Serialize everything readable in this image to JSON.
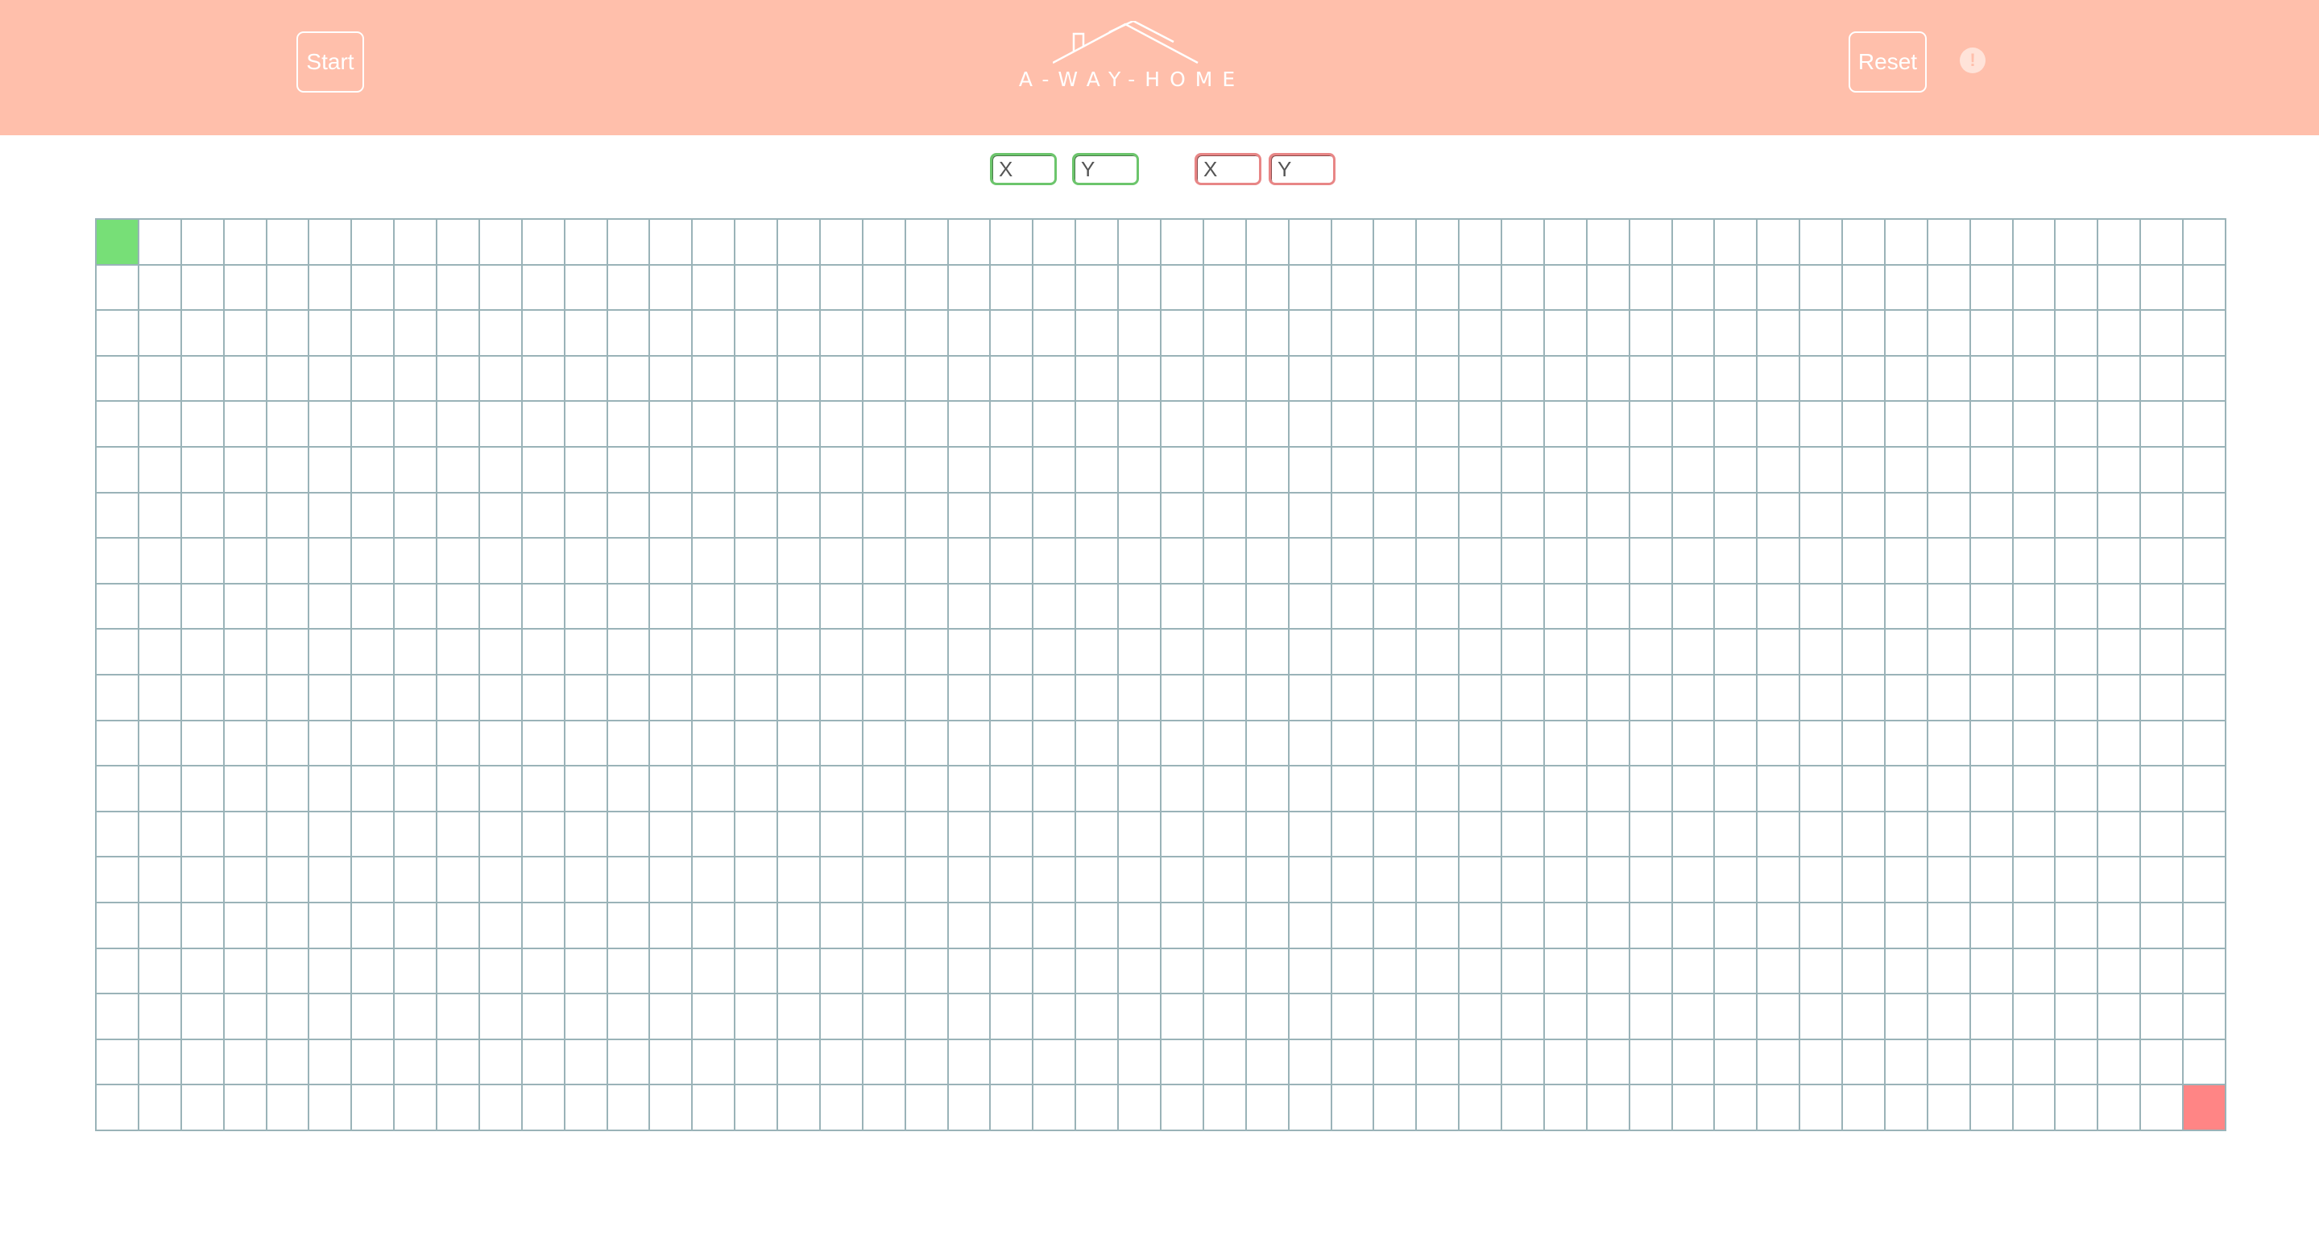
{
  "header": {
    "start_label": "Start",
    "reset_label": "Reset",
    "info_icon": "!",
    "logo_text": "A-WAY-HOME",
    "logo_icon": "house-roof-icon",
    "background_color": "#ffbfab"
  },
  "inputs": {
    "start_x_placeholder": "X",
    "start_y_placeholder": "Y",
    "end_x_placeholder": "X",
    "end_y_placeholder": "Y",
    "start_color": "#6cc56c",
    "end_color": "#e88686"
  },
  "grid": {
    "columns": 50,
    "rows": 20,
    "start_cell": {
      "row": 0,
      "col": 0,
      "color": "#77df77"
    },
    "end_cell": {
      "row": 19,
      "col": 49,
      "color": "#ff8585"
    },
    "line_color": "#9ab3b8"
  }
}
